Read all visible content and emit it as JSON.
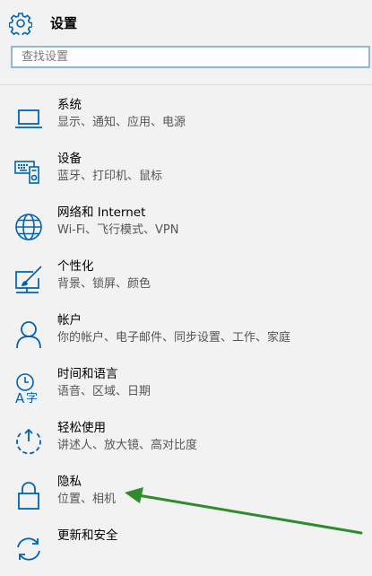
{
  "header": {
    "title": "设置"
  },
  "search": {
    "placeholder": "查找设置"
  },
  "accent_color": "#0063b1",
  "items": [
    {
      "name": "系统",
      "desc": "显示、通知、应用、电源",
      "icon": "laptop-icon"
    },
    {
      "name": "设备",
      "desc": "蓝牙、打印机、鼠标",
      "icon": "devices-icon"
    },
    {
      "name": "网络和 Internet",
      "desc": "Wi-Fi、飞行模式、VPN",
      "icon": "globe-icon"
    },
    {
      "name": "个性化",
      "desc": "背景、锁屏、颜色",
      "icon": "paint-icon"
    },
    {
      "name": "帐户",
      "desc": "你的帐户、电子邮件、同步设置、工作、家庭",
      "icon": "person-icon"
    },
    {
      "name": "时间和语言",
      "desc": "语音、区域、日期",
      "icon": "time-language-icon"
    },
    {
      "name": "轻松使用",
      "desc": "讲述人、放大镜、高对比度",
      "icon": "ease-of-access-icon"
    },
    {
      "name": "隐私",
      "desc": "位置、相机",
      "icon": "lock-icon"
    },
    {
      "name": "更新和安全",
      "desc": "",
      "icon": "update-icon"
    }
  ],
  "annotation": {
    "arrow_color": "#2e8b2e"
  }
}
